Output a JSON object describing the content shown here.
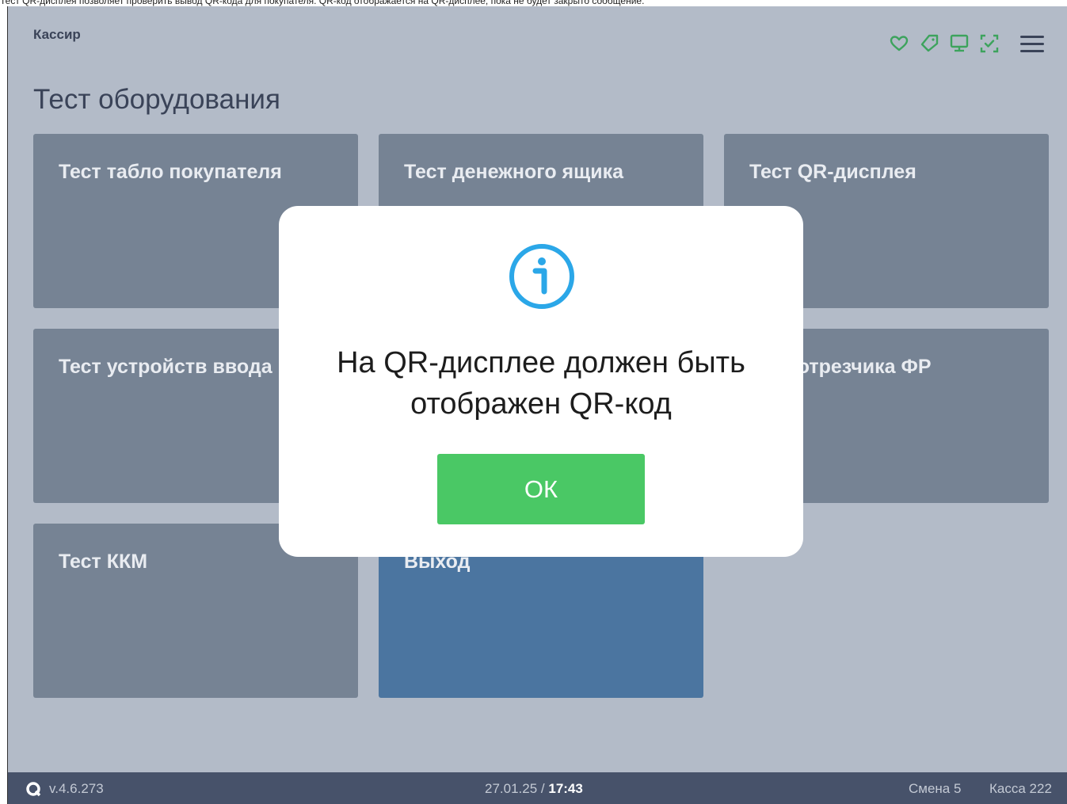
{
  "caption": "Тест QR-дисплея позволяет проверить вывод QR-кода для покупателя: QR-код отображается на QR-дисплее, пока не будет закрыто сообщение.",
  "header": {
    "user": "Кассир",
    "status_icons": [
      "heart-icon",
      "tag-icon",
      "display-icon",
      "scan-icon"
    ],
    "accent_color": "#3da35d"
  },
  "page": {
    "title": "Тест оборудования"
  },
  "tiles": [
    {
      "label": "Тест табло покупателя"
    },
    {
      "label": "Тест денежного ящика"
    },
    {
      "label": "Тест QR-дисплея"
    },
    {
      "label": "Тест устройств ввода"
    },
    {
      "label": ""
    },
    {
      "label": "Тест отрезчика ФР"
    },
    {
      "label": "Тест ККМ"
    },
    {
      "label": "Выход"
    }
  ],
  "modal": {
    "icon": "info-icon",
    "message_line1": "На QR-дисплее должен быть",
    "message_line2": "отображен QR-код",
    "ok_label": "ОК",
    "ok_color": "#4ac865"
  },
  "footer": {
    "version": "v.4.6.273",
    "date": "27.01.25",
    "separator": " / ",
    "time": "17:43",
    "shift": "Смена 5",
    "kassa": "Касса 222"
  }
}
